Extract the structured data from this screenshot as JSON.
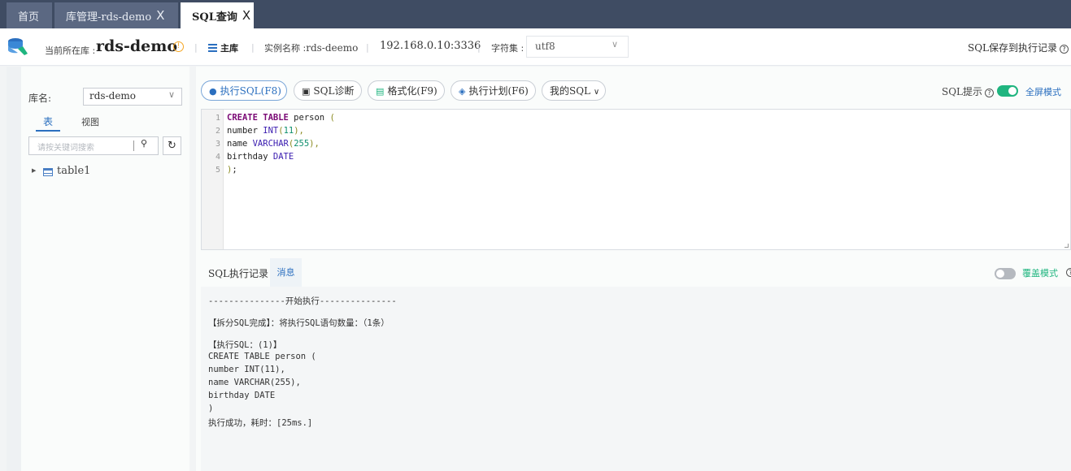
{
  "tabs": [
    {
      "label": "首页",
      "closable": false,
      "active": false
    },
    {
      "label": "库管理-rds-demo",
      "closable": true,
      "active": false
    },
    {
      "label": "SQL查询",
      "closable": true,
      "active": true
    }
  ],
  "close_glyph": "X",
  "infobar": {
    "current_db_label": "当前所在库 :",
    "current_db": "rds-demo",
    "info_icon": "!",
    "separator": "|",
    "master_label": "主库",
    "instance_label": "实例名称 :",
    "instance_name": "rds-deemo",
    "host": "192.168.0.10:3336",
    "charset_label": "字符集 :",
    "charset_value": "utf8",
    "save_label": "SQL保存到执行记录",
    "help_glyph": "?"
  },
  "sidebar": {
    "db_label": "库名:",
    "db_value": "rds-demo",
    "tab_table": "表",
    "tab_view": "视图",
    "search_placeholder": "请按关键词搜索",
    "search_icon_glyph": "⚲",
    "refresh_glyph": "↻",
    "tree": [
      {
        "label": "table1",
        "arrow": "▶"
      }
    ]
  },
  "toolbar": {
    "execute": "执行SQL(F8)",
    "diagnose": "SQL诊断",
    "format": "格式化(F9)",
    "plan": "执行计划(F6)",
    "my_sql": "我的SQL",
    "chevron": "∨",
    "sql_hint": "SQL提示",
    "sql_hint_enabled": true,
    "fullscreen": "全屏模式"
  },
  "editor": {
    "line_numbers": [
      "1",
      "2",
      "3",
      "4",
      "5"
    ],
    "lines": [
      {
        "kw": "CREATE TABLE",
        "rest": " person ",
        "p": "("
      },
      {
        "id": "number ",
        "ty": "INT",
        "p1": "(",
        "num": "11",
        "p2": "),"
      },
      {
        "id": "name ",
        "ty": "VARCHAR",
        "p1": "(",
        "num": "255",
        "p2": "),"
      },
      {
        "id": "birthday ",
        "ty": "DATE"
      },
      {
        "p": ")",
        "rest": ";"
      }
    ]
  },
  "results": {
    "tab_history": "SQL执行记录",
    "tab_message": "消息",
    "overwrite_mode": "覆盖模式",
    "overwrite_enabled": false,
    "lines": [
      "---------------开始执行---------------",
      "【拆分SQL完成】：将执行SQL语句数量：（1条）",
      "【执行SQL：(1)】",
      "CREATE TABLE person (",
      "number INT(11),",
      "name VARCHAR(255),",
      "birthday DATE",
      ")",
      "执行成功，耗时：[25ms.]"
    ]
  },
  "colors": {
    "tabbar_bg": "#3f4c63",
    "accent_blue": "#2b6fbf",
    "accent_green": "#1fb57f",
    "warning_orange": "#f5a623"
  }
}
